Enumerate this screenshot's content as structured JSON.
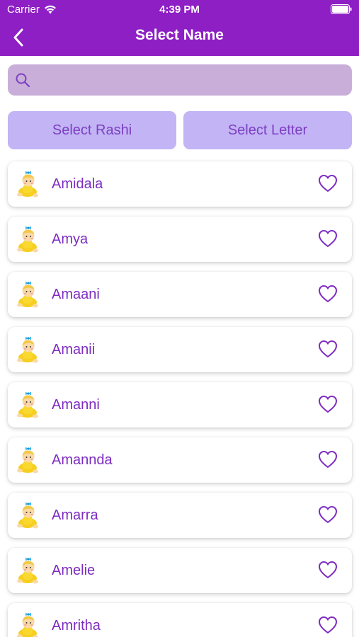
{
  "status_bar": {
    "carrier": "Carrier",
    "time": "4:39 PM"
  },
  "nav": {
    "title": "Select Name",
    "back_icon": "chevron-left-icon"
  },
  "search": {
    "placeholder": "",
    "value": "",
    "icon": "search-icon"
  },
  "filters": {
    "rashi_label": "Select Rashi",
    "letter_label": "Select Letter"
  },
  "names": [
    {
      "name": "Amidala"
    },
    {
      "name": "Amya"
    },
    {
      "name": "Amaani"
    },
    {
      "name": "Amanii"
    },
    {
      "name": "Amanni"
    },
    {
      "name": "Amannda"
    },
    {
      "name": "Amarra"
    },
    {
      "name": "Amelie"
    },
    {
      "name": "Amritha"
    }
  ],
  "colors": {
    "header": "#8e1fc4",
    "search_bg": "#c9aed9",
    "button_bg": "#c2b4f5",
    "accent": "#7d2cc0"
  }
}
